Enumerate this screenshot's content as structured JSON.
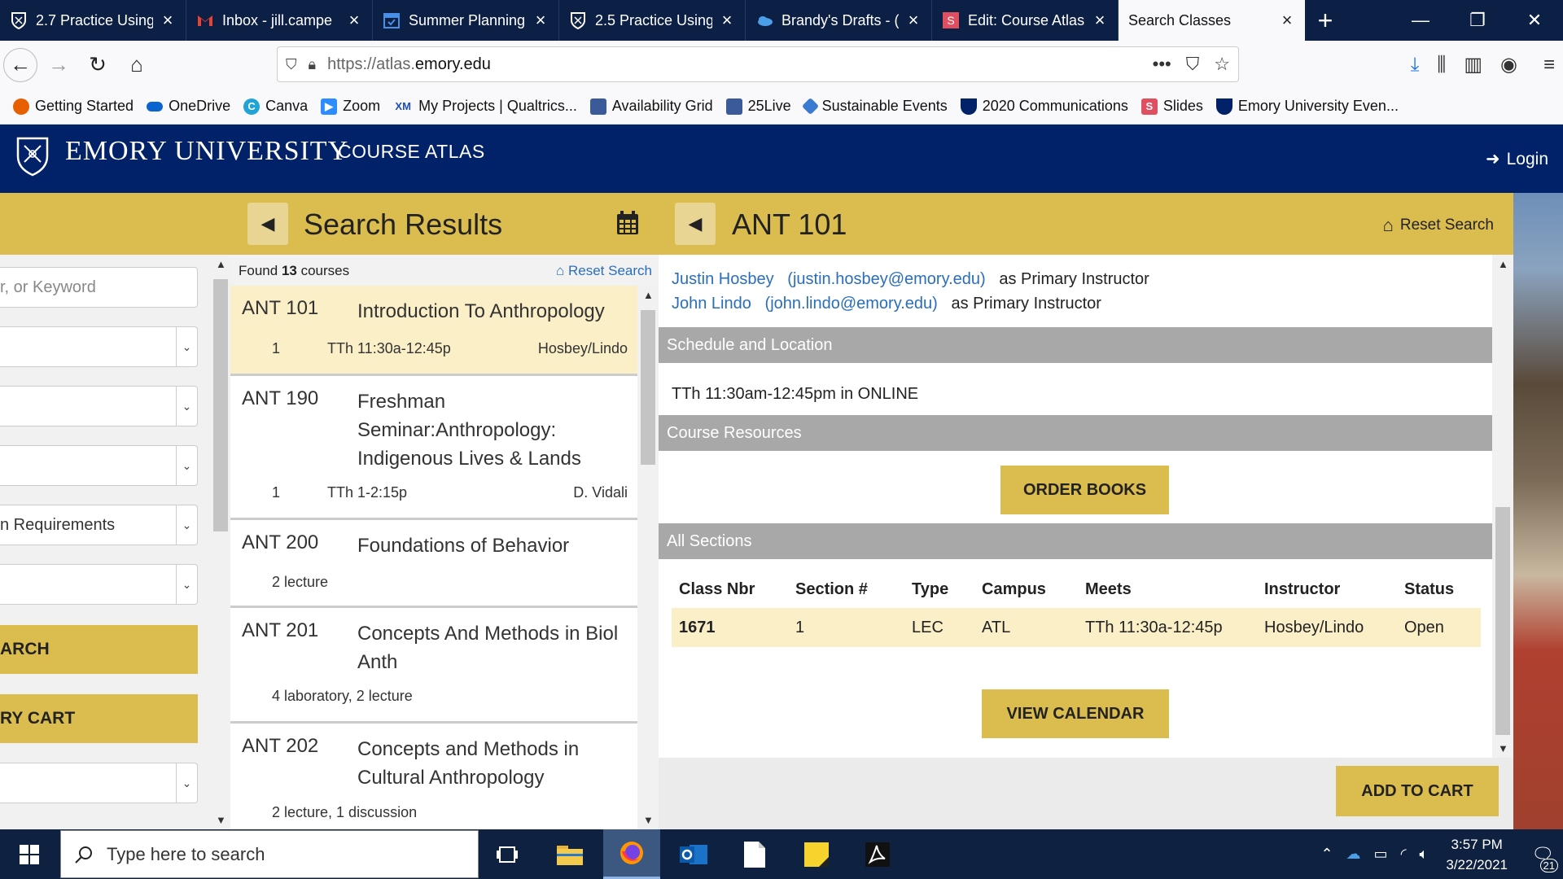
{
  "browser": {
    "tabs": [
      {
        "title": "2.7 Practice Using",
        "icon": "emory-shield-icon",
        "color": "#ffffff"
      },
      {
        "title": "Inbox - jill.campe",
        "icon": "gmail-icon",
        "color": "#ea4335"
      },
      {
        "title": "Summer Planning",
        "icon": "calendar-icon",
        "color": "#4a8fe7"
      },
      {
        "title": "2.5 Practice Using",
        "icon": "emory-shield-icon",
        "color": "#ffffff"
      },
      {
        "title": "Brandy's Drafts - (",
        "icon": "onedrive-icon",
        "color": "#4a9fe8"
      },
      {
        "title": "Edit: Course Atlas",
        "icon": "slides-icon",
        "color": "#e04f5f"
      },
      {
        "title": "Search Classes",
        "icon": "none",
        "color": "#ffffff"
      }
    ],
    "active_tab": 6,
    "url_prefix": "https://atlas.",
    "url_domain": "emory.edu",
    "bookmarks": [
      {
        "label": "Getting Started",
        "icon": "firefox-icon",
        "color": "#e66000"
      },
      {
        "label": "OneDrive",
        "icon": "onedrive-icon",
        "color": "#0a64d0"
      },
      {
        "label": "Canva",
        "icon": "canva-icon",
        "color": "#20a4d8",
        "glyph": "C"
      },
      {
        "label": "Zoom",
        "icon": "zoom-icon",
        "color": "#2d8cff"
      },
      {
        "label": "My Projects | Qualtrics...",
        "icon": "qualtrics-icon",
        "color": "#1d4fb8",
        "glyph": "XM"
      },
      {
        "label": "Availability Grid",
        "icon": "grid-icon",
        "color": "#3a5a9a"
      },
      {
        "label": "25Live",
        "icon": "25live-icon",
        "color": "#3a5a9a"
      },
      {
        "label": "Sustainable Events",
        "icon": "diamond-icon",
        "color": "#3a7ad0"
      },
      {
        "label": "2020 Communications",
        "icon": "emory-shield-icon",
        "color": "#012169"
      },
      {
        "label": "Slides",
        "icon": "slides-icon",
        "color": "#e04f5f",
        "glyph": "S"
      },
      {
        "label": "Emory University Even...",
        "icon": "emory-shield-icon",
        "color": "#012169"
      }
    ]
  },
  "site": {
    "university": "EMORY UNIVERSITY",
    "app": "COURSE ATLAS",
    "login": "Login",
    "brand_blue": "#012169",
    "gold": "#dbbc4e"
  },
  "filters": {
    "keyword_placeholder": "r, or Keyword",
    "requirements_label": "n Requirements",
    "search_button": "ARCH",
    "cart_button": "RY CART"
  },
  "results": {
    "title": "Search Results",
    "found_prefix": "Found",
    "found_count": "13",
    "found_suffix": "courses",
    "reset": "Reset Search",
    "courses": [
      {
        "code": "ANT 101",
        "title": "Introduction To Anthropology",
        "section": "1",
        "time": "TTh 11:30a-12:45p",
        "instructor": "Hosbey/Lindo"
      },
      {
        "code": "ANT 190",
        "title": "Freshman Seminar:Anthropology: Indigenous Lives & Lands",
        "section": "1",
        "time": "TTh 1-2:15p",
        "instructor": "D. Vidali"
      },
      {
        "code": "ANT 200",
        "title": "Foundations of Behavior",
        "components": "2 lecture"
      },
      {
        "code": "ANT 201",
        "title": "Concepts And Methods in Biol Anth",
        "components": "4 laboratory, 2 lecture"
      },
      {
        "code": "ANT 202",
        "title": "Concepts and Methods in Cultural Anthropology",
        "components": "2 lecture, 1 discussion"
      }
    ]
  },
  "detail": {
    "title": "ANT 101",
    "reset": "Reset Search",
    "instructors": [
      {
        "name": "Justin Hosbey",
        "email": "(justin.hosbey@emory.edu)",
        "role": "as Primary Instructor"
      },
      {
        "name": "John Lindo",
        "email": "(john.lindo@emory.edu)",
        "role": "as Primary Instructor"
      }
    ],
    "schedule_header": "Schedule and Location",
    "schedule": "TTh 11:30am-12:45pm in ONLINE",
    "resources_header": "Course Resources",
    "order_books": "ORDER BOOKS",
    "sections_header": "All Sections",
    "table_headers": [
      "Class Nbr",
      "Section #",
      "Type",
      "Campus",
      "Meets",
      "Instructor",
      "Status"
    ],
    "sections": [
      {
        "class_nbr": "1671",
        "section": "1",
        "type": "LEC",
        "campus": "ATL",
        "meets": "TTh 11:30a-12:45p",
        "instructor": "Hosbey/Lindo",
        "status": "Open"
      }
    ],
    "view_calendar": "VIEW CALENDAR",
    "add_to_cart": "ADD TO CART"
  },
  "taskbar": {
    "search_placeholder": "Type here to search",
    "time": "3:57 PM",
    "date": "3/22/2021",
    "notifications": "21",
    "apps": [
      "task-view-icon",
      "file-explorer-icon",
      "firefox-icon",
      "outlook-icon",
      "notepad-icon",
      "sticky-notes-icon",
      "acrobat-icon"
    ]
  }
}
